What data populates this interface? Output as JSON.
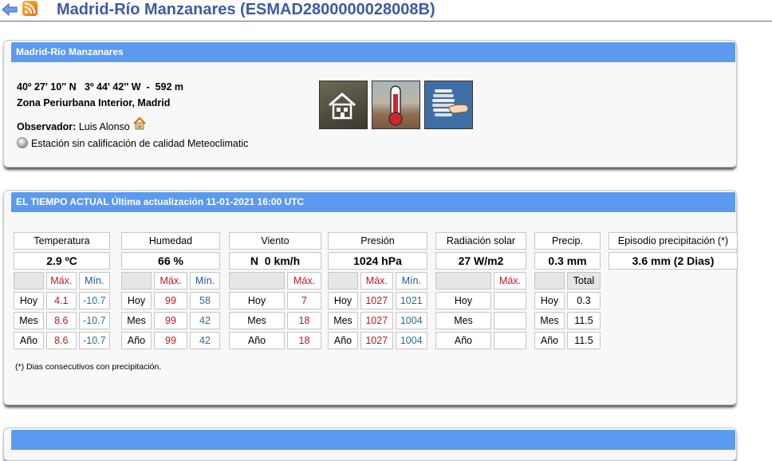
{
  "page": {
    "title": "Madrid-Río Manzanares (ESMAD2800000028008B)"
  },
  "station": {
    "header": "Madrid-Río Manzanares",
    "coords": "40º 27' 10'' N   3º 44' 42'' W  -  592 m",
    "zone": "Zona Periurbana Interior, Madrid",
    "observer_label": "Observador:",
    "observer_name": "Luis Alonso",
    "quality": "Estación sin calificación de calidad Meteoclimatic"
  },
  "current": {
    "header": "EL TIEMPO ACTUAL Última actualización 11-01-2021 16:00 UTC",
    "footnote": "(*) Dias consecutivos con precipitación.",
    "labels": {
      "max": "Máx.",
      "min": "Mín.",
      "total": "Total",
      "hoy": "Hoy",
      "mes": "Mes",
      "anio": "Año"
    },
    "temperatura": {
      "title": "Temperatura",
      "value": "2.9 ºC",
      "hoy": [
        "4.1",
        "-10.7"
      ],
      "mes": [
        "8.6",
        "-10.7"
      ],
      "anio": [
        "8.6",
        "-10.7"
      ]
    },
    "humedad": {
      "title": "Humedad",
      "value": "66 %",
      "hoy": [
        "99",
        "58"
      ],
      "mes": [
        "99",
        "42"
      ],
      "anio": [
        "99",
        "42"
      ]
    },
    "viento": {
      "title": "Viento",
      "value": "N  0 km/h",
      "hoy": "7",
      "mes": "18",
      "anio": "18"
    },
    "presion": {
      "title": "Presión",
      "value": "1024 hPa",
      "hoy": [
        "1027",
        "1021"
      ],
      "mes": [
        "1027",
        "1004"
      ],
      "anio": [
        "1027",
        "1004"
      ]
    },
    "radiacion": {
      "title": "Radiación solar",
      "value": "27 W/m2"
    },
    "precip": {
      "title": "Precip.",
      "value": "0.3 mm",
      "hoy": "0.3",
      "mes": "11.5",
      "anio": "11.5"
    },
    "episodio": {
      "title": "Episodio precipitación (*)",
      "value": "3.6 mm (2 Dias)"
    }
  }
}
